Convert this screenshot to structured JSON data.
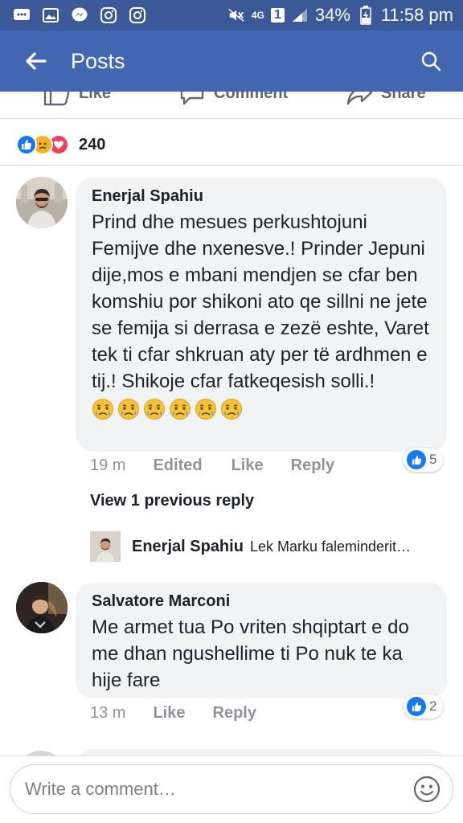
{
  "status_bar": {
    "network": "4G",
    "sim": "1",
    "battery": "34%",
    "time": "11:58 pm",
    "icons": [
      "chat-icon",
      "gallery-icon",
      "messenger-icon",
      "instagram-icon",
      "instagram-icon",
      "mute-icon",
      "signal-icon",
      "battery-icon"
    ]
  },
  "header": {
    "title": "Posts",
    "bg_color": "#4267b2"
  },
  "post_actions": [
    {
      "label": "Like",
      "icon": "thumbs-up-icon"
    },
    {
      "label": "Comment",
      "icon": "comment-icon"
    },
    {
      "label": "Share",
      "icon": "share-icon"
    }
  ],
  "reactions": {
    "types": [
      "like",
      "sad",
      "love"
    ],
    "count": "240"
  },
  "comments": [
    {
      "author": "Enerjal Spahiu",
      "text": "Prind dhe mesues perkushtojuni Femijve dhe nxenesve.! Prinder Jepuni dije,mos e mbani mendjen se cfar ben komshiu por shikoni ato qe sillni ne jete se femija si derrasa e zezë eshte, Varet tek ti cfar shkruan aty per të ardhmen e tij.! Shikoje cfar fatkeqesish solli.!",
      "emojis": [
        "crying-face-icon",
        "crying-face-icon",
        "crying-face-icon",
        "crying-face-icon",
        "crying-face-icon",
        "crying-face-icon"
      ],
      "time": "19 m",
      "edited_label": "Edited",
      "like_label": "Like",
      "reply_label": "Reply",
      "likes": "5"
    },
    {
      "author": "Salvatore Marconi",
      "text": "Me armet tua Po vriten shqiptart e do me dhan ngushellime ti Po nuk te ka hije fare",
      "time": "13 m",
      "like_label": "Like",
      "reply_label": "Reply",
      "likes": "2"
    }
  ],
  "replies": {
    "view_previous_label": "View 1 previous reply",
    "latest": {
      "author": "Enerjal Spahiu",
      "snippet": "Lek Marku  faleminderit…"
    }
  },
  "composer": {
    "placeholder": "Write a comment…"
  },
  "colors": {
    "brand": "#4267b2",
    "status_bar": "#3b5998",
    "bubble": "#f2f3f5",
    "like_blue": "#1877f2"
  }
}
